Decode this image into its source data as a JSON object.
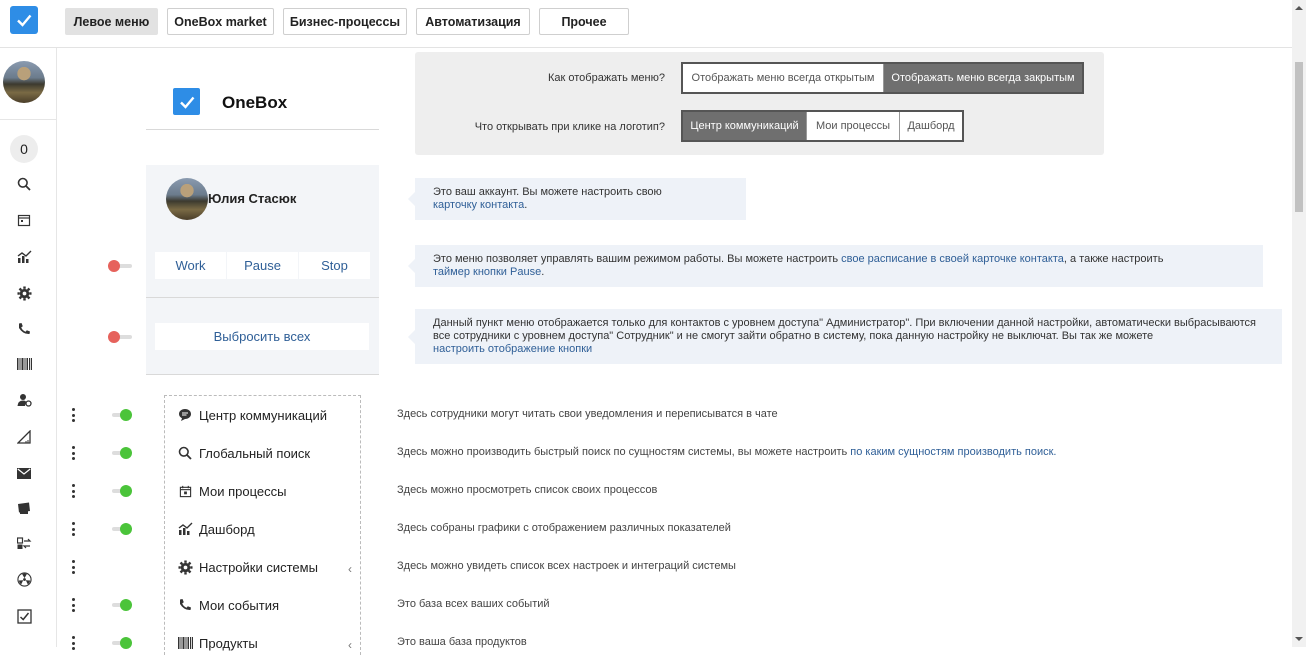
{
  "topbar": {
    "tabs": [
      {
        "label": "Левое меню",
        "active": true
      },
      {
        "label": "OneBox market",
        "active": false
      },
      {
        "label": "Бизнес-процессы",
        "active": false
      },
      {
        "label": "Автоматизация",
        "active": false
      },
      {
        "label": "Прочее",
        "active": false
      }
    ]
  },
  "sidebar": {
    "counter": "0",
    "icons": [
      "search-icon",
      "calendar-icon",
      "chart-icon",
      "gear-icon",
      "phone-icon",
      "barcode-icon",
      "user-settings-icon",
      "ruler-icon",
      "mail-icon",
      "printer-icon",
      "transfer-icon",
      "radiation-icon",
      "checkbox-icon"
    ]
  },
  "preview": {
    "brand": "OneBox",
    "user_name": "Юлия Стасюк",
    "modes": [
      "Work",
      "Pause",
      "Stop"
    ],
    "kick_all": "Выбросить всех"
  },
  "settings": {
    "menu_display_label": "Как отображать меню?",
    "menu_display_options": [
      {
        "label": "Отображать меню всегда открытым",
        "selected": false
      },
      {
        "label": "Отображать меню всегда закрытым",
        "selected": true
      }
    ],
    "logo_click_label": "Что открывать при клике на логотип?",
    "logo_click_options": [
      {
        "label": "Центр коммуникаций",
        "selected": true
      },
      {
        "label": "Мои процессы",
        "selected": false
      },
      {
        "label": "Дашборд",
        "selected": false
      }
    ]
  },
  "tips": {
    "account": {
      "text": "Это ваш аккаунт. Вы можете настроить свою",
      "link": "карточку контакта",
      "end": "."
    },
    "mode": {
      "text": "Это меню позволяет управлять вашим режимом работы. Вы можете настроить ",
      "link1": "свое расписание в своей карточке контакта",
      "mid": ", а также настроить",
      "link2": "таймер кнопки Pause",
      "end": "."
    },
    "kick": {
      "text": "Данный пункт меню отображается только для контактов с уровнем доступа\" Администратор\". При включении данной настройки, автоматически выбрасываются все сотрудники с уровнем доступа\" Сотрудник\" и не смогут зайти обратно в систему, пока данную настройку не выключат. Вы так же можете",
      "link": "настроить отображение кнопки"
    }
  },
  "menu_items": [
    {
      "label": "Центр коммуникаций",
      "icon": "chat-icon",
      "toggle": true,
      "chevron": false,
      "desc": "Здесь сотрудники могут читать свои уведомления и переписыватся в чате",
      "link": ""
    },
    {
      "label": "Глобальный поиск",
      "icon": "search-icon",
      "toggle": true,
      "chevron": false,
      "desc": "Здесь можно производить быстрый поиск по сущностям системы, вы можете настроить ",
      "link": "по каким сущностям производить поиск."
    },
    {
      "label": "Мои процессы",
      "icon": "calendar-icon",
      "toggle": true,
      "chevron": false,
      "desc": "Здесь можно просмотреть список своих процессов",
      "link": ""
    },
    {
      "label": "Дашборд",
      "icon": "chart-icon",
      "toggle": true,
      "chevron": false,
      "desc": "Здесь собраны графики с отображением различных показателей",
      "link": ""
    },
    {
      "label": "Настройки системы",
      "icon": "gear-icon",
      "toggle": false,
      "chevron": true,
      "desc": "Здесь можно увидеть список всех настроек и интеграций системы",
      "link": ""
    },
    {
      "label": "Мои события",
      "icon": "phone-icon",
      "toggle": true,
      "chevron": false,
      "desc": "Это база всех ваших событий",
      "link": ""
    },
    {
      "label": "Продукты",
      "icon": "barcode-icon",
      "toggle": true,
      "chevron": true,
      "desc": "Это ваша база продуктов",
      "link": ""
    }
  ]
}
